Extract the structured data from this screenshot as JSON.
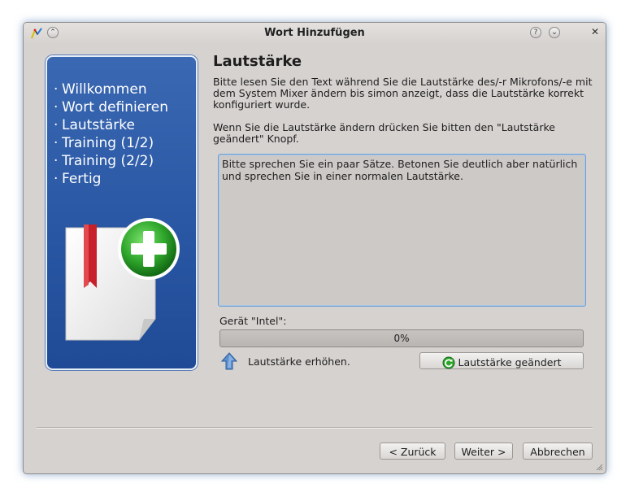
{
  "window": {
    "title": "Wort Hinzufügen"
  },
  "sidebar": {
    "steps": [
      {
        "bullet": "·",
        "label": "Willkommen"
      },
      {
        "bullet": "·",
        "label": "Wort definieren"
      },
      {
        "bullet": "·",
        "label": "Lautstärke"
      },
      {
        "bullet": "·",
        "label": "Training (1/2)"
      },
      {
        "bullet": "·",
        "label": "Training (2/2)"
      },
      {
        "bullet": "·",
        "label": "Fertig"
      }
    ]
  },
  "page": {
    "heading": "Lautstärke",
    "intro": "Bitte lesen Sie den Text während Sie die Lautstärke des/-r Mikrofons/-e mit dem System Mixer ändern bis simon anzeigt, dass die Lautstärke korrekt konfiguriert wurde.",
    "instruction": "Wenn Sie die Lautstärke ändern drücken Sie bitten den \"Lautstärke geändert\" Knopf.",
    "prompt_text": "Bitte sprechen Sie ein paar Sätze. Betonen Sie deutlich aber natürlich und sprechen Sie in einer normalen Lautstärke.",
    "device_label": "Gerät \"Intel\":",
    "progress_value": 0,
    "progress_text": "0%",
    "hint_text": "Lautstärke erhöhen.",
    "volume_changed_button": "Lautstärke geändert"
  },
  "footer": {
    "back_button": "< Zurück",
    "next_button": "Weiter >",
    "cancel_button": "Abbrechen"
  },
  "colors": {
    "panel_blue": "#2c5aa6",
    "accent_blue": "#6da0d4",
    "bookmark_red": "#c8202a",
    "plus_green": "#2ea52b"
  }
}
